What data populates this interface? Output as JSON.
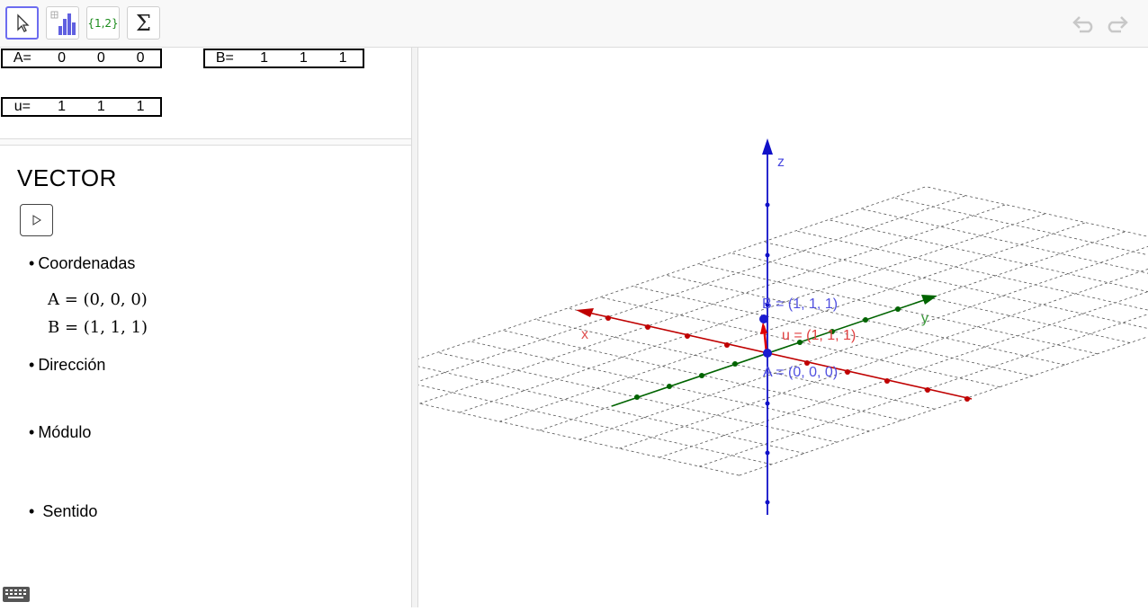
{
  "toolbar": {
    "tools": [
      {
        "name": "move-tool",
        "icon": "cursor-arrow-icon"
      },
      {
        "name": "statistics-tool",
        "icon": "bar-chart-icon"
      },
      {
        "name": "list-tool",
        "icon": "list-braces-icon",
        "label": "{1,2}"
      },
      {
        "name": "sum-tool",
        "icon": "sigma-icon",
        "label": "Σ"
      }
    ],
    "undo_icon": "undo-icon",
    "redo_icon": "redo-icon"
  },
  "spreadsheet": {
    "a": {
      "label": "A=",
      "values": [
        "0",
        "0",
        "0"
      ]
    },
    "b": {
      "label": "B=",
      "values": [
        "1",
        "1",
        "1"
      ]
    },
    "u": {
      "label": "u=",
      "values": [
        "1",
        "1",
        "1"
      ]
    }
  },
  "doc": {
    "title": "VECTOR",
    "play_icon": "play-icon",
    "coords_label": "Coordenadas",
    "a_eq": "A = (0, 0, 0)",
    "b_eq": "B = (1, 1, 1)",
    "direction_label": "Dirección",
    "module_label": "Módulo",
    "sense_label": "Sentido",
    "bullet": "•"
  },
  "graphics3d": {
    "axis_x_label": "x",
    "axis_y_label": "y",
    "axis_z_label": "z",
    "point_a_label": "A = (0, 0, 0)",
    "point_b_label": "B = (1, 1, 1)",
    "vector_u_label": "u = (1, 1, 1)",
    "colors": {
      "x_axis": "#c00000",
      "y_axis": "#006400",
      "z_axis": "#1010c8",
      "points": "#1a1ad0",
      "vector": "#e00000",
      "grid": "#555555"
    }
  },
  "keyboard_icon": "keyboard-icon"
}
